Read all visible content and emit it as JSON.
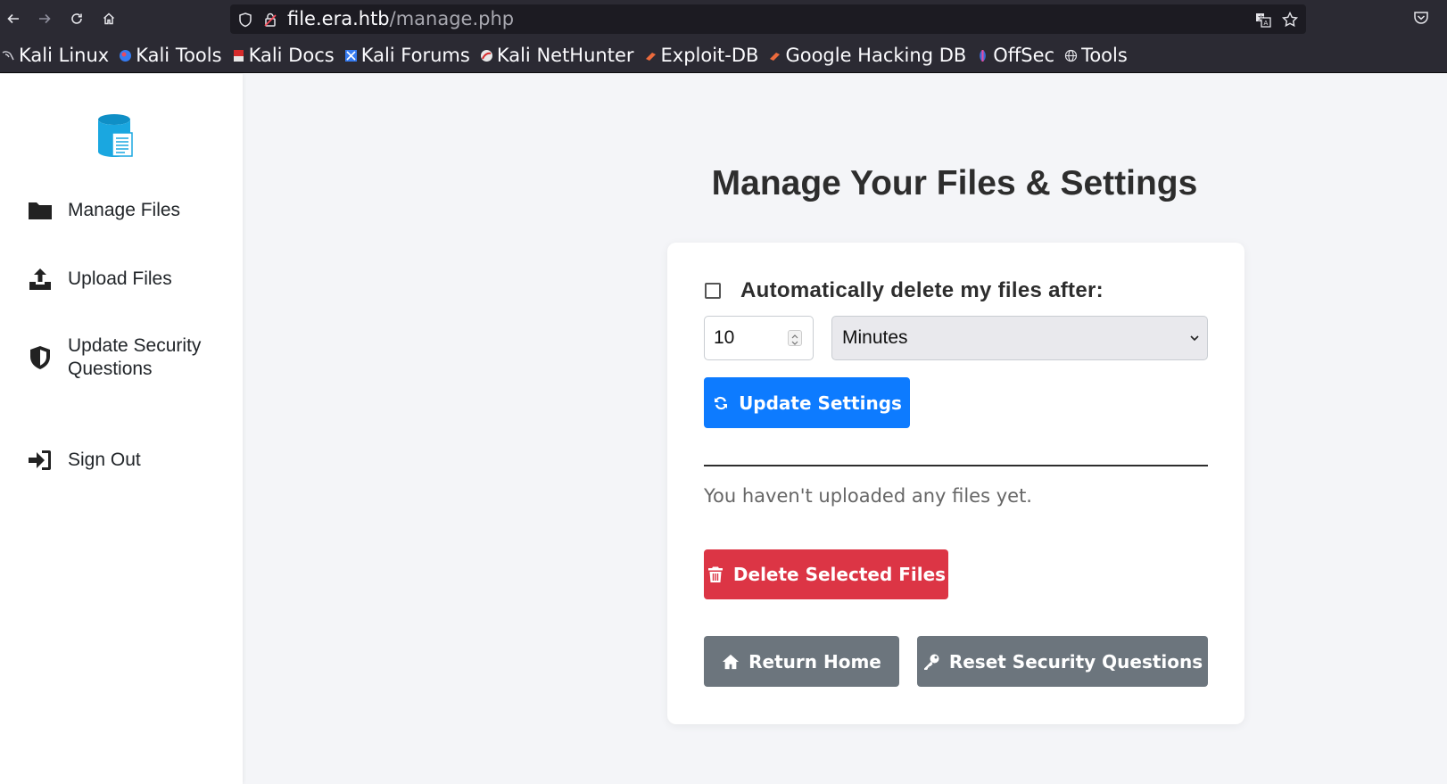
{
  "browser": {
    "url_host": "file.era.htb",
    "url_path": "/manage.php"
  },
  "bookmarks": [
    {
      "label": "Kali Linux"
    },
    {
      "label": "Kali Tools"
    },
    {
      "label": "Kali Docs"
    },
    {
      "label": "Kali Forums"
    },
    {
      "label": "Kali NetHunter"
    },
    {
      "label": "Exploit-DB"
    },
    {
      "label": "Google Hacking DB"
    },
    {
      "label": "OffSec"
    },
    {
      "label": "Tools"
    }
  ],
  "sidebar": {
    "items": [
      {
        "label": "Manage Files",
        "icon": "folder-icon"
      },
      {
        "label": "Upload Files",
        "icon": "upload-icon"
      },
      {
        "label": "Update Security Questions",
        "icon": "shield-icon"
      },
      {
        "label": "Sign Out",
        "icon": "sign-out-icon"
      }
    ]
  },
  "main": {
    "title": "Manage Your Files & Settings",
    "auto_delete_label": "Automatically delete my files after:",
    "auto_delete_checked": false,
    "duration_value": "10",
    "duration_unit": "Minutes",
    "update_button": "Update Settings",
    "empty_message": "You haven't uploaded any files yet.",
    "delete_button": "Delete Selected Files",
    "home_button": "Return Home",
    "reset_button": "Reset Security Questions"
  },
  "colors": {
    "primary": "#0d7bff",
    "danger": "#dc3545",
    "secondary": "#6c757d",
    "logo": "#1aa7e0"
  }
}
